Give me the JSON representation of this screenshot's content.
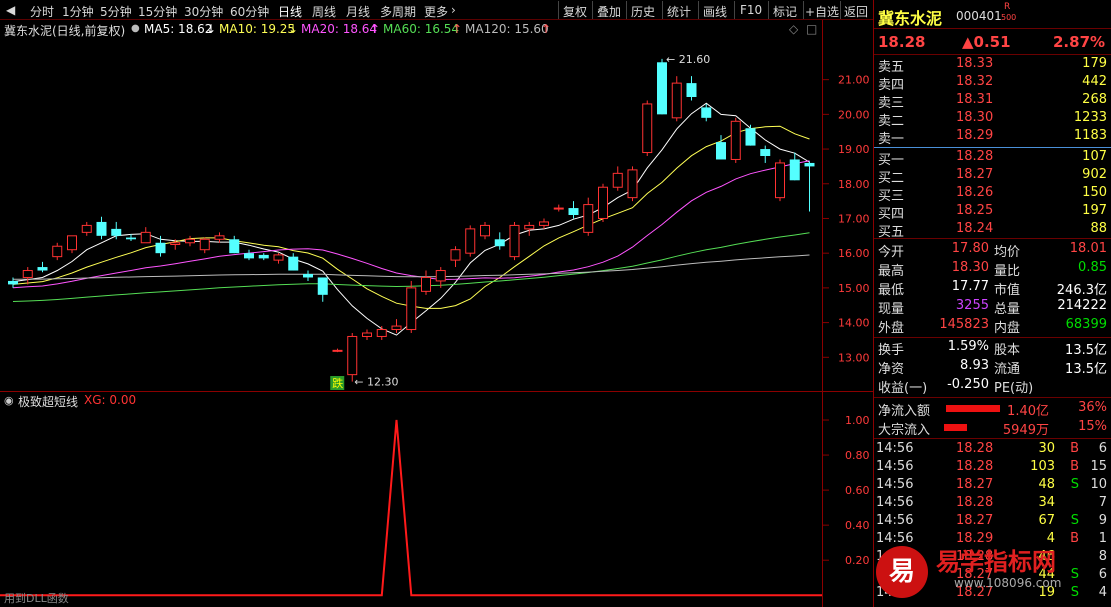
{
  "toolbar": {
    "periods": [
      "分时",
      "1分钟",
      "5分钟",
      "15分钟",
      "30分钟",
      "60分钟",
      "日线",
      "周线",
      "月线",
      "多周期",
      "更多"
    ],
    "active_period": "日线",
    "actions": [
      "复权",
      "叠加",
      "历史",
      "统计",
      "画线",
      "F10",
      "标记",
      "+自选",
      "返回"
    ]
  },
  "legend": {
    "title": "冀东水泥(日线,前复权)",
    "ma5": "MA5: 18.62",
    "ma10": "MA10: 19.25",
    "ma20": "MA20: 18.64",
    "ma60": "MA60: 16.54",
    "ma120": "MA120: 15.60",
    "arrow_down": "↓",
    "arrow_up": "↑",
    "diamond": "◇",
    "square": "□",
    "colors": {
      "ma5": "#ffffff",
      "ma10": "#ffff55",
      "ma20": "#ff55ff",
      "ma60": "#55dd55",
      "ma120": "#bbbbbb"
    }
  },
  "chart_data": [
    {
      "type": "candlestick",
      "title": "冀东水泥(日线,前复权)",
      "yticks": [
        "21.00",
        "20.00",
        "19.00",
        "18.00",
        "17.00",
        "16.00",
        "15.00",
        "14.00",
        "13.00"
      ],
      "ylim": [
        12.3,
        22.0
      ],
      "annotations": {
        "high_label": "21.60",
        "low_label": "12.30",
        "signal_label": "跌"
      },
      "candles": [
        {
          "o": 15.2,
          "h": 15.3,
          "l": 15.0,
          "c": 15.1
        },
        {
          "o": 15.3,
          "h": 15.6,
          "l": 15.1,
          "c": 15.5
        },
        {
          "o": 15.6,
          "h": 15.75,
          "l": 15.45,
          "c": 15.5
        },
        {
          "o": 15.9,
          "h": 16.3,
          "l": 15.8,
          "c": 16.2
        },
        {
          "o": 16.1,
          "h": 16.5,
          "l": 16.0,
          "c": 16.5
        },
        {
          "o": 16.6,
          "h": 16.9,
          "l": 16.5,
          "c": 16.8
        },
        {
          "o": 16.9,
          "h": 17.05,
          "l": 16.4,
          "c": 16.5
        },
        {
          "o": 16.7,
          "h": 16.9,
          "l": 16.4,
          "c": 16.5
        },
        {
          "o": 16.45,
          "h": 16.55,
          "l": 16.35,
          "c": 16.4
        },
        {
          "o": 16.3,
          "h": 16.75,
          "l": 16.3,
          "c": 16.6
        },
        {
          "o": 16.3,
          "h": 16.5,
          "l": 15.9,
          "c": 16.0
        },
        {
          "o": 16.25,
          "h": 16.4,
          "l": 16.1,
          "c": 16.3
        },
        {
          "o": 16.3,
          "h": 16.5,
          "l": 16.2,
          "c": 16.4
        },
        {
          "o": 16.1,
          "h": 16.45,
          "l": 16.0,
          "c": 16.4
        },
        {
          "o": 16.4,
          "h": 16.6,
          "l": 16.3,
          "c": 16.5
        },
        {
          "o": 16.4,
          "h": 16.5,
          "l": 16.0,
          "c": 16.0
        },
        {
          "o": 16.0,
          "h": 16.1,
          "l": 15.8,
          "c": 15.85
        },
        {
          "o": 15.95,
          "h": 16.0,
          "l": 15.8,
          "c": 15.85
        },
        {
          "o": 15.8,
          "h": 16.0,
          "l": 15.7,
          "c": 15.95
        },
        {
          "o": 15.9,
          "h": 16.0,
          "l": 15.5,
          "c": 15.5
        },
        {
          "o": 15.4,
          "h": 15.5,
          "l": 15.2,
          "c": 15.3
        },
        {
          "o": 15.3,
          "h": 15.3,
          "l": 14.6,
          "c": 14.8
        },
        {
          "o": 13.2,
          "h": 13.25,
          "l": 13.15,
          "c": 13.2
        },
        {
          "o": 12.5,
          "h": 13.7,
          "l": 12.3,
          "c": 13.6
        },
        {
          "o": 13.6,
          "h": 13.8,
          "l": 13.5,
          "c": 13.7
        },
        {
          "o": 13.6,
          "h": 13.9,
          "l": 13.5,
          "c": 13.8
        },
        {
          "o": 13.8,
          "h": 14.1,
          "l": 13.7,
          "c": 13.9
        },
        {
          "o": 13.8,
          "h": 15.2,
          "l": 13.7,
          "c": 15.0
        },
        {
          "o": 14.9,
          "h": 15.5,
          "l": 14.8,
          "c": 15.3
        },
        {
          "o": 15.2,
          "h": 15.6,
          "l": 15.0,
          "c": 15.5
        },
        {
          "o": 15.8,
          "h": 16.2,
          "l": 15.6,
          "c": 16.1
        },
        {
          "o": 16.0,
          "h": 16.8,
          "l": 15.9,
          "c": 16.7
        },
        {
          "o": 16.5,
          "h": 16.9,
          "l": 16.4,
          "c": 16.8
        },
        {
          "o": 16.4,
          "h": 16.6,
          "l": 16.1,
          "c": 16.2
        },
        {
          "o": 15.9,
          "h": 16.9,
          "l": 15.8,
          "c": 16.8
        },
        {
          "o": 16.7,
          "h": 16.9,
          "l": 16.5,
          "c": 16.8
        },
        {
          "o": 16.8,
          "h": 17.0,
          "l": 16.7,
          "c": 16.9
        },
        {
          "o": 17.3,
          "h": 17.4,
          "l": 17.2,
          "c": 17.3
        },
        {
          "o": 17.3,
          "h": 17.5,
          "l": 17.0,
          "c": 17.1
        },
        {
          "o": 16.6,
          "h": 17.6,
          "l": 16.5,
          "c": 17.4
        },
        {
          "o": 17.0,
          "h": 18.0,
          "l": 16.9,
          "c": 17.9
        },
        {
          "o": 17.9,
          "h": 18.5,
          "l": 17.8,
          "c": 18.3
        },
        {
          "o": 17.6,
          "h": 18.5,
          "l": 17.5,
          "c": 18.4
        },
        {
          "o": 18.9,
          "h": 20.4,
          "l": 18.8,
          "c": 20.3
        },
        {
          "o": 21.5,
          "h": 21.6,
          "l": 20.0,
          "c": 20.0
        },
        {
          "o": 19.9,
          "h": 21.1,
          "l": 19.8,
          "c": 20.9
        },
        {
          "o": 20.9,
          "h": 21.1,
          "l": 20.4,
          "c": 20.5
        },
        {
          "o": 20.2,
          "h": 20.3,
          "l": 19.8,
          "c": 19.9
        },
        {
          "o": 19.2,
          "h": 19.4,
          "l": 18.7,
          "c": 18.7
        },
        {
          "o": 18.7,
          "h": 19.9,
          "l": 18.6,
          "c": 19.8
        },
        {
          "o": 19.6,
          "h": 19.7,
          "l": 19.1,
          "c": 19.1
        },
        {
          "o": 19.0,
          "h": 19.1,
          "l": 18.6,
          "c": 18.8
        },
        {
          "o": 17.6,
          "h": 18.7,
          "l": 17.5,
          "c": 18.6
        },
        {
          "o": 18.7,
          "h": 18.9,
          "l": 18.1,
          "c": 18.1
        },
        {
          "o": 18.6,
          "h": 18.65,
          "l": 17.2,
          "c": 18.5
        }
      ]
    },
    {
      "type": "line",
      "title": "极致超短线",
      "series": [
        {
          "name": "XG: 0.00",
          "values": [
            0,
            0,
            0,
            0,
            0,
            0,
            0,
            0,
            0,
            0,
            0,
            0,
            0,
            0,
            0,
            0,
            0,
            0,
            0,
            0,
            0,
            0,
            0,
            0,
            0,
            0,
            1,
            0,
            0,
            0,
            0,
            0,
            0,
            0,
            0,
            0,
            0,
            0,
            0,
            0,
            0,
            0,
            0,
            0,
            0,
            0,
            0,
            0,
            0,
            0,
            0,
            0,
            0,
            0,
            0
          ]
        }
      ],
      "yticks": [
        "1.00",
        "0.80",
        "0.60",
        "0.40",
        "0.20"
      ],
      "ylim": [
        -0.05,
        1.15
      ]
    }
  ],
  "indicator": {
    "title": "极致超短线",
    "value": "XG: 0.00",
    "footer": "用到DLL函数"
  },
  "quote": {
    "name": "冀东水泥",
    "code": "000401",
    "badge_top": "R",
    "badge_bottom": "500",
    "price": "18.28",
    "change": "▲0.51",
    "pct": "2.87%",
    "asks": [
      {
        "label": "卖五",
        "price": "18.33",
        "vol": "179"
      },
      {
        "label": "卖四",
        "price": "18.32",
        "vol": "442"
      },
      {
        "label": "卖三",
        "price": "18.31",
        "vol": "268"
      },
      {
        "label": "卖二",
        "price": "18.30",
        "vol": "1233"
      },
      {
        "label": "卖一",
        "price": "18.29",
        "vol": "1183"
      }
    ],
    "bids": [
      {
        "label": "买一",
        "price": "18.28",
        "vol": "107"
      },
      {
        "label": "买二",
        "price": "18.27",
        "vol": "902"
      },
      {
        "label": "买三",
        "price": "18.26",
        "vol": "150"
      },
      {
        "label": "买四",
        "price": "18.25",
        "vol": "197"
      },
      {
        "label": "买五",
        "price": "18.24",
        "vol": "88"
      }
    ],
    "stats": [
      {
        "l1": "今开",
        "v1": "17.80",
        "c1": "#ff4444",
        "l2": "均价",
        "v2": "18.01",
        "c2": "#ff4444"
      },
      {
        "l1": "最高",
        "v1": "18.30",
        "c1": "#ff4444",
        "l2": "量比",
        "v2": "0.85",
        "c2": "#00dd00"
      },
      {
        "l1": "最低",
        "v1": "17.77",
        "c1": "#ffffff",
        "l2": "市值",
        "v2": "246.3亿",
        "c2": "#ffffff"
      },
      {
        "l1": "现量",
        "v1": "3255",
        "c1": "#cc44ff",
        "l2": "总量",
        "v2": "214222",
        "c2": "#ffffff"
      },
      {
        "l1": "外盘",
        "v1": "145823",
        "c1": "#ff4444",
        "l2": "内盘",
        "v2": "68399",
        "c2": "#00dd00"
      }
    ],
    "stats2": [
      {
        "l1": "换手",
        "v1": "1.59%",
        "l2": "股本",
        "v2": "13.5亿"
      },
      {
        "l1": "净资",
        "v1": "8.93",
        "l2": "流通",
        "v2": "13.5亿"
      },
      {
        "l1": "收益(一)",
        "v1": "-0.250",
        "l2": "PE(动)",
        "v2": ""
      }
    ],
    "flow": [
      {
        "label": "净流入额",
        "value": "1.40亿",
        "pct": "36%",
        "bar": 0.36
      },
      {
        "label": "大宗流入",
        "value": "5949万",
        "pct": "15%",
        "bar": 0.15
      }
    ],
    "ticks": [
      {
        "time": "14:56",
        "price": "18.28",
        "vol": "30",
        "side": "B",
        "n": "6"
      },
      {
        "time": "14:56",
        "price": "18.28",
        "vol": "103",
        "side": "B",
        "n": "15"
      },
      {
        "time": "14:56",
        "price": "18.27",
        "vol": "48",
        "side": "S",
        "n": "10"
      },
      {
        "time": "14:56",
        "price": "18.28",
        "vol": "34",
        "side": "",
        "n": "7"
      },
      {
        "time": "14:56",
        "price": "18.27",
        "vol": "67",
        "side": "S",
        "n": "9"
      },
      {
        "time": "14:56",
        "price": "18.29",
        "vol": "4",
        "side": "B",
        "n": "1"
      },
      {
        "time": "14:56",
        "price": "18.28",
        "vol": "46",
        "side": "",
        "n": "8"
      },
      {
        "time": "14:56",
        "price": "18.27",
        "vol": "44",
        "side": "S",
        "n": "6"
      },
      {
        "time": "14:56",
        "price": "18.27",
        "vol": "19",
        "side": "S",
        "n": "4"
      }
    ]
  },
  "watermark": {
    "char": "易",
    "text": "易学指标网",
    "url": "www.108096.com"
  }
}
